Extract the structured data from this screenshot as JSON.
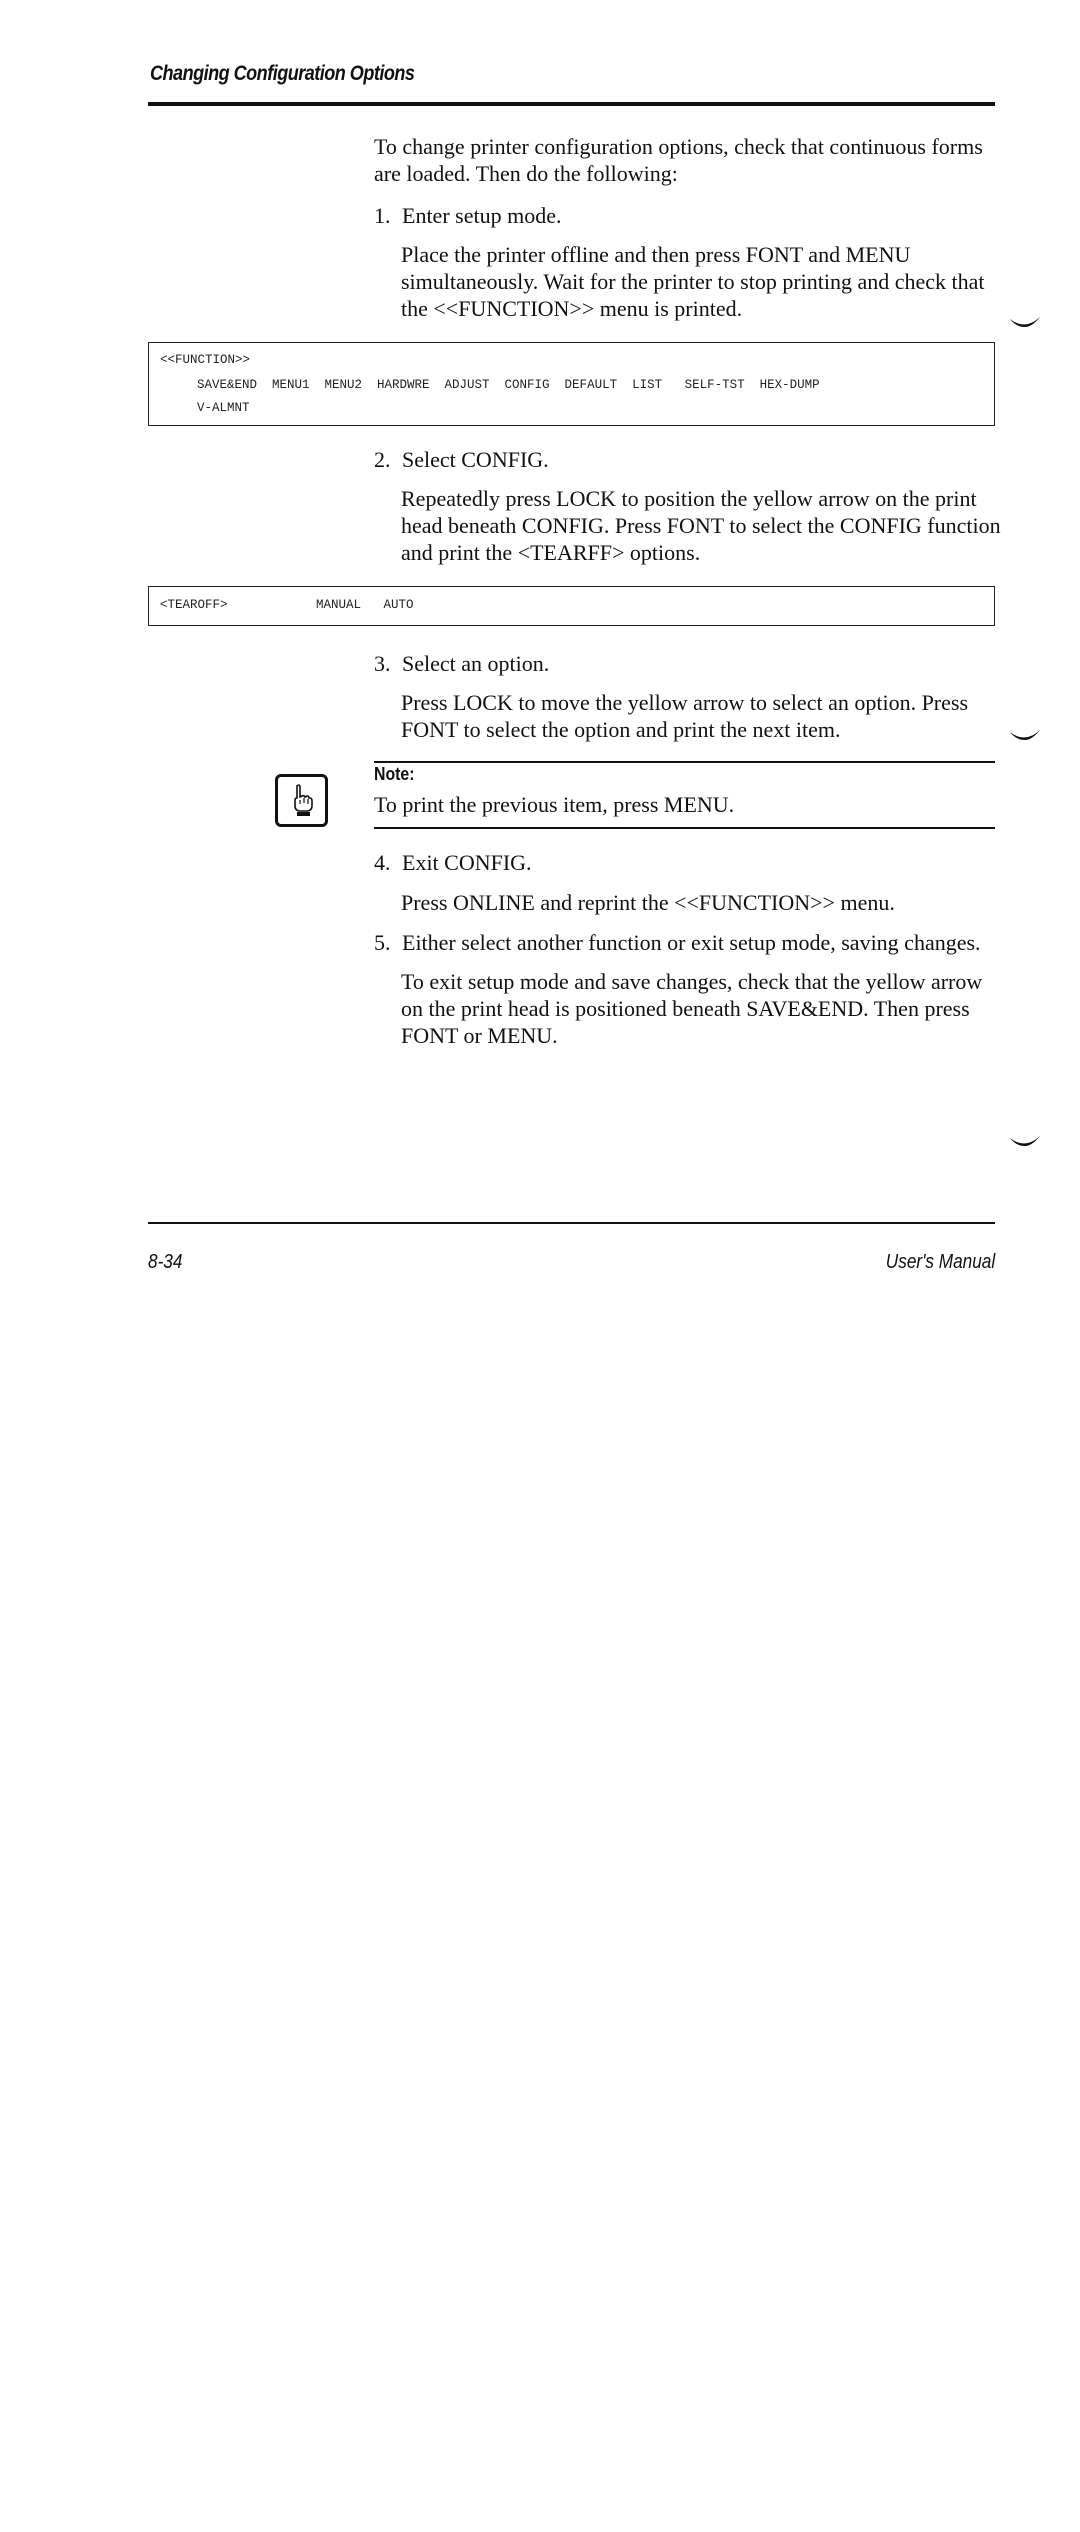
{
  "header": {
    "section_title": "Changing Configuration Options"
  },
  "intro": "To change printer configuration options, check that continuous forms are loaded. Then do the following:",
  "steps": [
    {
      "number": "1.",
      "title": "Enter setup mode.",
      "body": "Place the printer offline and then press FONT and MENU simultaneously. Wait for the printer to stop printing and check that the <<FUNCTION>> menu is printed."
    },
    {
      "number": "2.",
      "title": "Select CONFIG.",
      "body": "Repeatedly press LOCK to position the yellow arrow on the print head beneath CONFIG. Press FONT to select the CONFIG function and print the <TEARFF> options."
    },
    {
      "number": "3.",
      "title": "Select an option.",
      "body": "Press LOCK to move the yellow arrow to select an option. Press FONT to select the option and print the next item."
    },
    {
      "number": "4.",
      "title": "Exit CONFIG.",
      "body": "Press ONLINE and reprint the <<FUNCTION>> menu."
    },
    {
      "number": "5.",
      "title": "Either select another function or exit setup mode, saving changes.",
      "body": "To exit setup mode and save changes, check that the yellow arrow on the print head is positioned beneath SAVE&END. Then press FONT or MENU."
    }
  ],
  "function_printout": {
    "heading": "<<FUNCTION>>",
    "items_line1": "SAVE&END  MENU1  MENU2  HARDWRE  ADJUST  CONFIG  DEFAULT  LIST   SELF-TST  HEX-DUMP",
    "items_line2": "V-ALMNT"
  },
  "tearoff_printout": {
    "heading": "<TEAROFF>",
    "options": "MANUAL   AUTO"
  },
  "note": {
    "label": "Note:",
    "text": "To print the previous item, press MENU.",
    "icon": "pointing-hand-icon"
  },
  "footer": {
    "page_number": "8-34",
    "manual_title": "User's Manual"
  }
}
